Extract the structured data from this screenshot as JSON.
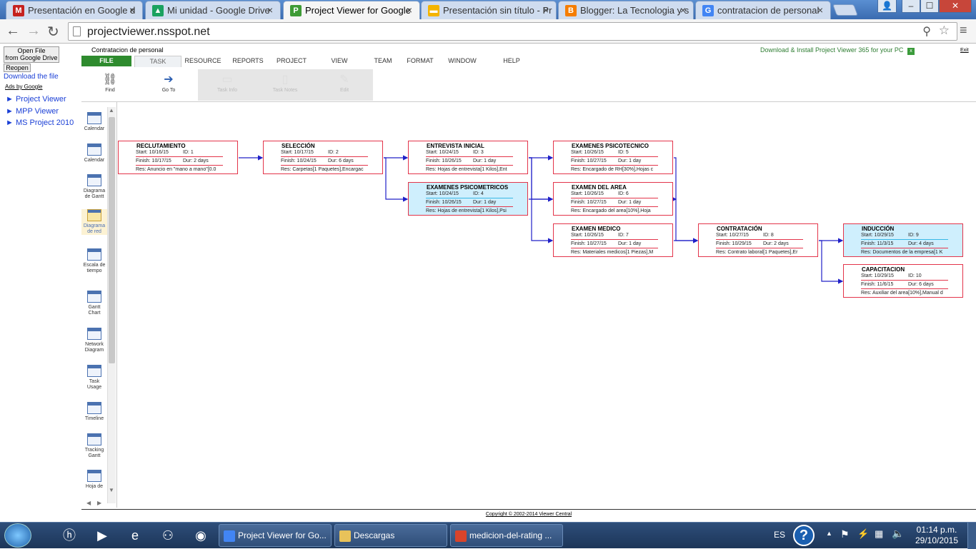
{
  "browser": {
    "tabs": [
      {
        "title": "Presentación en Google d",
        "icon": "gmail-icon",
        "color": "#c5221f",
        "glyph": "M"
      },
      {
        "title": "Mi unidad - Google Drive",
        "icon": "drive-icon",
        "color": "#1aa260",
        "glyph": "▲"
      },
      {
        "title": "Project Viewer for Google",
        "icon": "project-viewer-icon",
        "color": "#3e9b35",
        "glyph": "P",
        "active": true
      },
      {
        "title": "Presentación sin título - Pr",
        "icon": "slides-icon",
        "color": "#f4b400",
        "glyph": "▬"
      },
      {
        "title": "Blogger: La Tecnologia y s",
        "icon": "blogger-icon",
        "color": "#f57d00",
        "glyph": "B"
      },
      {
        "title": "contratacion de personal",
        "icon": "google-icon",
        "color": "#4285f4",
        "glyph": "G"
      }
    ],
    "close_glyph": "×",
    "url": "projectviewer.nsspot.net",
    "window_buttons": {
      "user": "👤",
      "minimize": "‒",
      "maximize": "☐",
      "close": "✕"
    }
  },
  "sidebar": {
    "open_file_label_1": "Open File",
    "open_file_label_2": "from Google Drive",
    "reopen_label": "Reopen",
    "download_link": "Download the file",
    "ads_label": "Ads by Google",
    "ad_links": [
      "► Project Viewer",
      "► MPP Viewer",
      "► MS Project 2010"
    ]
  },
  "app": {
    "file_name": "Contratacion de personal",
    "download_promo": "Download & Install Project Viewer 365 for your PC",
    "exit_label": "Exit",
    "menu": [
      "FILE",
      "TASK",
      "RESOURCE",
      "REPORTS",
      "PROJECT",
      "VIEW",
      "TEAM",
      "FORMAT",
      "WINDOW",
      "HELP"
    ],
    "active_menu": "TASK",
    "ribbon": [
      {
        "label": "Find",
        "icon": "binoculars-icon",
        "glyph": "⛓",
        "enabled": true
      },
      {
        "label": "Go To",
        "icon": "arrow-right-icon",
        "glyph": "➔",
        "enabled": true
      },
      {
        "label": "Task Info",
        "icon": "task-info-icon",
        "glyph": "▭",
        "enabled": false
      },
      {
        "label": "Task Notes",
        "icon": "task-notes-icon",
        "glyph": "▯",
        "enabled": false
      },
      {
        "label": "Edit",
        "icon": "edit-icon",
        "glyph": "✎",
        "enabled": false
      }
    ],
    "views": [
      {
        "label": "Calendar",
        "selected": false
      },
      {
        "label": "Calendar",
        "selected": false
      },
      {
        "label": "Diagrama de Gantt",
        "selected": false
      },
      {
        "label": "Diagrama de red",
        "selected": true
      },
      {
        "label": "Escala de tiempo",
        "selected": false
      },
      {
        "label": "Gantt Chart",
        "selected": false
      },
      {
        "label": "Network Diagram",
        "selected": false
      },
      {
        "label": "Task Usage",
        "selected": false
      },
      {
        "label": "Timeline",
        "selected": false
      },
      {
        "label": "Tracking Gantt",
        "selected": false
      },
      {
        "label": "Hoja de",
        "selected": false
      }
    ],
    "copyright": "Copyright © 2002-2014 Viewer Central"
  },
  "network": {
    "nodes": [
      {
        "name": "RECLUTAMIENTO",
        "start": "Start: 10/16/15",
        "id": "ID: 1",
        "finish": "Finish: 10/17/15",
        "dur": "Dur: 2 days",
        "res": "Res: Anuncio en \"mano a mano\"[0.0",
        "critical": false
      },
      {
        "name": "SELECCIÓN",
        "start": "Start: 10/17/15",
        "id": "ID: 2",
        "finish": "Finish: 10/24/15",
        "dur": "Dur: 6 days",
        "res": "Res: Carpetas[1 Paquetes],Encargac",
        "critical": false
      },
      {
        "name": "ENTREVISTA INICIAL",
        "start": "Start: 10/24/15",
        "id": "ID: 3",
        "finish": "Finish: 10/26/15",
        "dur": "Dur: 1 day",
        "res": "Res: Hojas de entrevista[1 Kilos],Ent",
        "critical": false
      },
      {
        "name": "EXAMENES PSICOMETRICOS",
        "start": "Start: 10/24/15",
        "id": "ID: 4",
        "finish": "Finish: 10/26/15",
        "dur": "Dur: 1 day",
        "res": "Res: Hojas de entrevista[1 Kilos],Psi",
        "critical": true
      },
      {
        "name": "EXAMENES PSICOTECNICO",
        "start": "Start: 10/26/15",
        "id": "ID: 5",
        "finish": "Finish: 10/27/15",
        "dur": "Dur: 1 day",
        "res": "Res: Encargado de RH[30%],Hojas c",
        "critical": false
      },
      {
        "name": "EXAMEN DEL AREA",
        "start": "Start: 10/26/15",
        "id": "ID: 6",
        "finish": "Finish: 10/27/15",
        "dur": "Dur: 1 day",
        "res": "Res: Encargado del area[10%],Hoja",
        "critical": false
      },
      {
        "name": "EXAMEN MEDICO",
        "start": "Start: 10/26/15",
        "id": "ID: 7",
        "finish": "Finish: 10/27/15",
        "dur": "Dur: 1 day",
        "res": "Res: Materiales medicos[1 Piezas],M",
        "critical": false
      },
      {
        "name": "CONTRATACIÓN",
        "start": "Start: 10/27/15",
        "id": "ID: 8",
        "finish": "Finish: 10/29/15",
        "dur": "Dur: 2 days",
        "res": "Res: Contrato laboral[1 Paquetes],Er",
        "critical": false
      },
      {
        "name": "INDUCCIÓN",
        "start": "Start: 10/29/15",
        "id": "ID: 9",
        "finish": "Finish: 11/3/15",
        "dur": "Dur: 4 days",
        "res": "Res: Documentos de la empresa[1 K",
        "critical": true
      },
      {
        "name": "CAPACITACION",
        "start": "Start: 10/29/15",
        "id": "ID: 10",
        "finish": "Finish: 11/6/15",
        "dur": "Dur: 6 days",
        "res": "Res: Auxiliar del area[10%],Manual d",
        "critical": false
      }
    ]
  },
  "taskbar": {
    "start_icon": "windows-start-icon",
    "pinned": [
      {
        "icon": "hp-icon",
        "glyph": "ⓗ"
      },
      {
        "icon": "media-player-icon",
        "glyph": "▶"
      },
      {
        "icon": "internet-explorer-icon",
        "glyph": "e"
      },
      {
        "icon": "network-icon",
        "glyph": "⚇"
      },
      {
        "icon": "firefox-icon",
        "glyph": "◉"
      }
    ],
    "tasks": [
      {
        "label": "Project Viewer for Go...",
        "color": "#4285f4"
      },
      {
        "label": "Descargas",
        "color": "#e8c25a"
      },
      {
        "label": "medicion-del-rating ...",
        "color": "#d9442b"
      }
    ],
    "language": "ES",
    "time": "01:14 p.m.",
    "date": "29/10/2015"
  }
}
